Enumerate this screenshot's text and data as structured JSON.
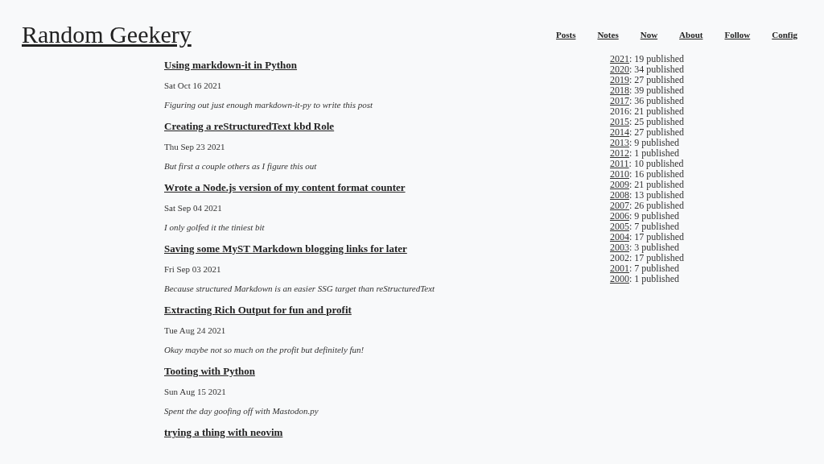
{
  "site_title": "Random Geekery",
  "nav": [
    "Posts",
    "Notes",
    "Now",
    "About",
    "Follow",
    "Config"
  ],
  "posts": [
    {
      "title": "Using markdown-it in Python",
      "date": "Sat Oct 16 2021",
      "summary": "Figuring out just enough markdown-it-py to write this post"
    },
    {
      "title": "Creating a reStructuredText kbd Role",
      "date": "Thu Sep 23 2021",
      "summary": "But first a couple others as I figure this out"
    },
    {
      "title": "Wrote a Node.js version of my content format counter",
      "date": "Sat Sep 04 2021",
      "summary": "I only golfed it the tiniest bit"
    },
    {
      "title": "Saving some MyST Markdown blogging links for later",
      "date": "Fri Sep 03 2021",
      "summary": "Because structured Markdown is an easier SSG target than reStructuredText"
    },
    {
      "title": "Extracting Rich Output for fun and profit",
      "date": "Tue Aug 24 2021",
      "summary": "Okay maybe not so much on the profit but definitely fun!"
    },
    {
      "title": "Tooting with Python",
      "date": "Sun Aug 15 2021",
      "summary": "Spent the day goofing off with Mastodon.py"
    },
    {
      "title": "trying a thing with neovim"
    }
  ],
  "archive": [
    {
      "year": "2021",
      "count": ": 19 published",
      "linked": true
    },
    {
      "year": "2020",
      "count": ": 34 published",
      "linked": true
    },
    {
      "year": "2019",
      "count": ": 27 published",
      "linked": true
    },
    {
      "year": "2018",
      "count": ": 39 published",
      "linked": true
    },
    {
      "year": "2017",
      "count": ": 36 published",
      "linked": true
    },
    {
      "year": "2016",
      "count": ": 21 published",
      "linked": false
    },
    {
      "year": "2015",
      "count": ": 25 published",
      "linked": true
    },
    {
      "year": "2014",
      "count": ": 27 published",
      "linked": true
    },
    {
      "year": "2013",
      "count": ": 9 published",
      "linked": true
    },
    {
      "year": "2012",
      "count": ": 1 published",
      "linked": true
    },
    {
      "year": "2011",
      "count": ": 10 published",
      "linked": true
    },
    {
      "year": "2010",
      "count": ": 16 published",
      "linked": true
    },
    {
      "year": "2009",
      "count": ": 21 published",
      "linked": true
    },
    {
      "year": "2008",
      "count": ": 13 published",
      "linked": true
    },
    {
      "year": "2007",
      "count": ": 26 published",
      "linked": true
    },
    {
      "year": "2006",
      "count": ": 9 published",
      "linked": true
    },
    {
      "year": "2005",
      "count": ": 7 published",
      "linked": true
    },
    {
      "year": "2004",
      "count": ": 17 published",
      "linked": true
    },
    {
      "year": "2003",
      "count": ": 3 published",
      "linked": true
    },
    {
      "year": "2002",
      "count": ": 17 published",
      "linked": false
    },
    {
      "year": "2001",
      "count": ": 7 published",
      "linked": true
    },
    {
      "year": "2000",
      "count": ": 1 published",
      "linked": true
    }
  ]
}
